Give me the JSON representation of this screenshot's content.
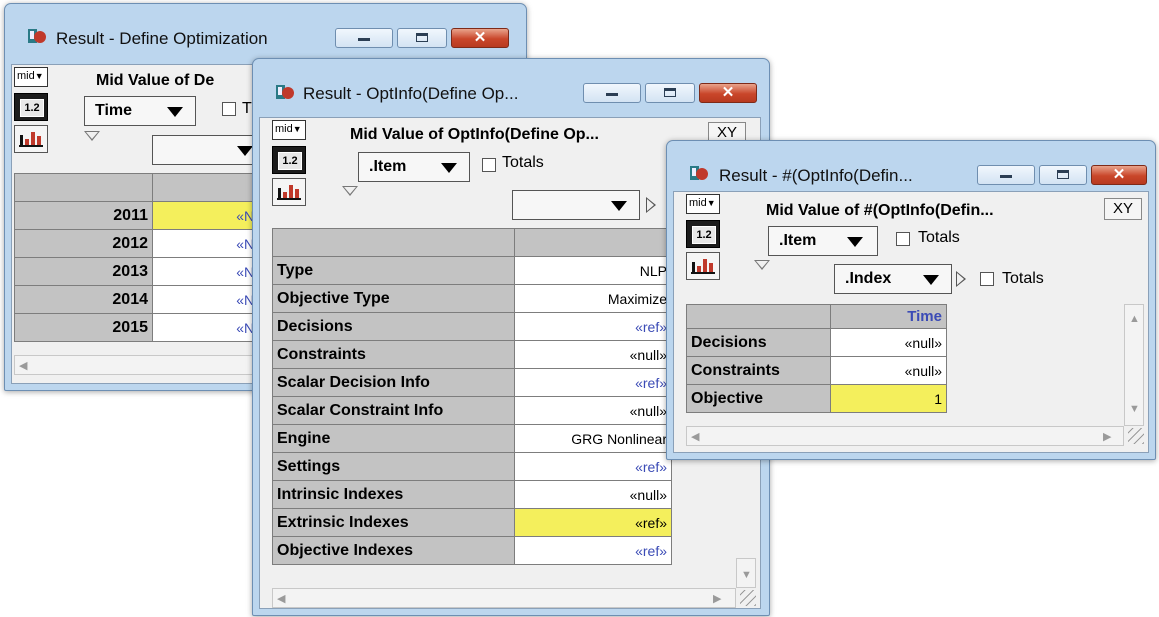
{
  "win1": {
    "title": "Result - Define Optimization",
    "mid_label": "mid",
    "view_label": "1.2",
    "heading": "Mid Value of De",
    "index_dropdown": "Time",
    "totals_label": "T",
    "rows": [
      {
        "year": "2011",
        "value": "«NLP»",
        "highlight": true
      },
      {
        "year": "2012",
        "value": "«NLP»"
      },
      {
        "year": "2013",
        "value": "«NLP»"
      },
      {
        "year": "2014",
        "value": "«NLP»"
      },
      {
        "year": "2015",
        "value": "«NLP»"
      }
    ]
  },
  "win2": {
    "title": "Result - OptInfo(Define Op...",
    "mid_label": "mid",
    "view_label": "1.2",
    "heading": "Mid Value of OptInfo(Define Op...",
    "xy_label": "XY",
    "index_dropdown": ".Item",
    "totals_label": "Totals",
    "rows": [
      {
        "label": "Type",
        "value": "NLP"
      },
      {
        "label": "Objective Type",
        "value": "Maximize"
      },
      {
        "label": "Decisions",
        "value": "«ref»"
      },
      {
        "label": "Constraints",
        "value": "«null»"
      },
      {
        "label": "Scalar Decision Info",
        "value": "«ref»"
      },
      {
        "label": "Scalar Constraint Info",
        "value": "«null»"
      },
      {
        "label": "Engine",
        "value": "GRG Nonlinear"
      },
      {
        "label": "Settings",
        "value": "«ref»"
      },
      {
        "label": "Intrinsic Indexes",
        "value": "«null»"
      },
      {
        "label": "Extrinsic Indexes",
        "value": "«ref»"
      },
      {
        "label": "Objective Indexes",
        "value": "«ref»"
      }
    ]
  },
  "win3": {
    "title": "Result - #(OptInfo(Defin...",
    "mid_label": "mid",
    "view_label": "1.2",
    "heading": "Mid Value of #(OptInfo(Defin...",
    "xy_label": "XY",
    "index_dropdown": ".Item",
    "totals_label": "Totals",
    "col_index_dropdown": ".Index",
    "col_totals_label": "Totals",
    "column_header": "Time",
    "rows": [
      {
        "label": "Decisions",
        "value": "«null»"
      },
      {
        "label": "Constraints",
        "value": "«null»"
      },
      {
        "label": "Objective",
        "value": "1"
      }
    ]
  },
  "colors": {
    "highlight": "#f4ef5c",
    "link": "#3b4bb6",
    "header_gray": "#c3c3c3",
    "window_frame": "#bcd6ee",
    "close_red": "#c9462a"
  }
}
